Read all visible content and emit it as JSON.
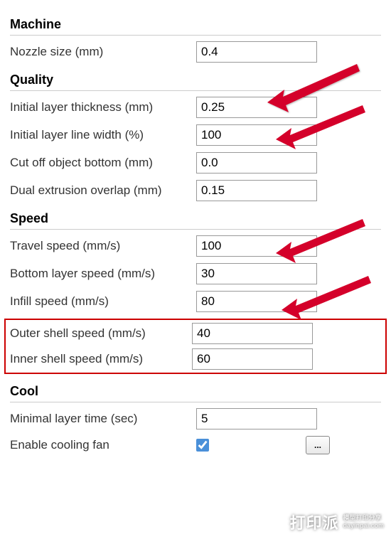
{
  "sections": {
    "machine": {
      "title": "Machine",
      "nozzle_size": {
        "label": "Nozzle size (mm)",
        "value": "0.4"
      }
    },
    "quality": {
      "title": "Quality",
      "initial_layer_thickness": {
        "label": "Initial layer thickness (mm)",
        "value": "0.25"
      },
      "initial_layer_line_width": {
        "label": "Initial layer line width (%)",
        "value": "100"
      },
      "cut_off_bottom": {
        "label": "Cut off object bottom (mm)",
        "value": "0.0"
      },
      "dual_extrusion_overlap": {
        "label": "Dual extrusion overlap (mm)",
        "value": "0.15"
      }
    },
    "speed": {
      "title": "Speed",
      "travel_speed": {
        "label": "Travel speed (mm/s)",
        "value": "100"
      },
      "bottom_layer_speed": {
        "label": "Bottom layer speed (mm/s)",
        "value": "30"
      },
      "infill_speed": {
        "label": "Infill speed (mm/s)",
        "value": "80"
      },
      "outer_shell_speed": {
        "label": "Outer shell speed (mm/s)",
        "value": "40"
      },
      "inner_shell_speed": {
        "label": "Inner shell speed (mm/s)",
        "value": "60"
      }
    },
    "cool": {
      "title": "Cool",
      "minimal_layer_time": {
        "label": "Minimal layer time (sec)",
        "value": "5"
      },
      "enable_cooling_fan": {
        "label": "Enable cooling fan",
        "checked": true
      },
      "more_button": "..."
    }
  },
  "watermark": {
    "logo": "打印派",
    "sub1": "模型打印分享",
    "sub2": "dayinpai.com"
  }
}
